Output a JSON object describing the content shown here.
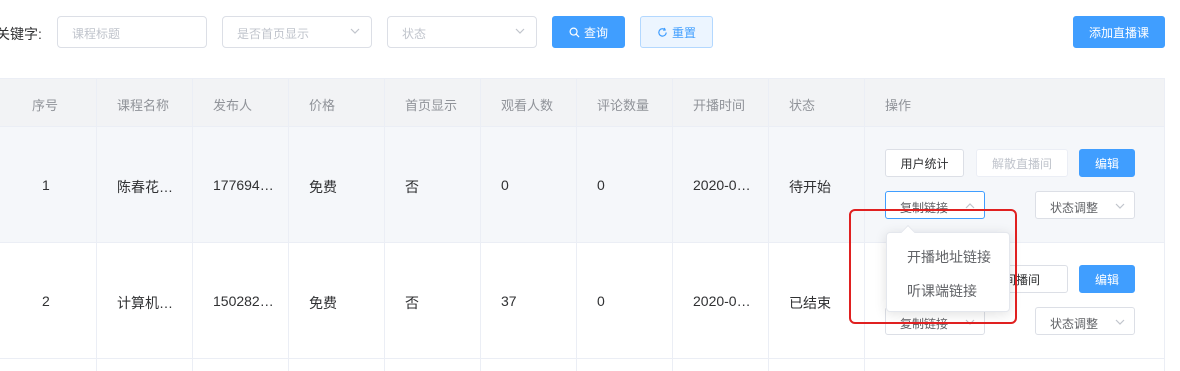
{
  "filters": {
    "keyword_label": "关键字:",
    "title_placeholder": "课程标题",
    "homepage_placeholder": "是否首页显示",
    "status_placeholder": "状态",
    "search_label": "查询",
    "reset_label": "重置",
    "add_label": "添加直播课"
  },
  "table": {
    "columns": [
      "序号",
      "课程名称",
      "发布人",
      "价格",
      "首页显示",
      "观看人数",
      "评论数量",
      "开播时间",
      "状态",
      "操作"
    ],
    "rows": [
      {
        "index": "1",
        "name": "陈春花…",
        "publisher": "177694…",
        "price": "免费",
        "homepage": "否",
        "viewers": "0",
        "comments": "0",
        "start_time": "2020-0…",
        "status": "待开始"
      },
      {
        "index": "2",
        "name": "计算机…",
        "publisher": "150282…",
        "price": "免费",
        "homepage": "否",
        "viewers": "37",
        "comments": "0",
        "start_time": "2020-0…",
        "status": "已结束"
      }
    ],
    "actions": {
      "user_stats": "用户统计",
      "dissolve_room": "解散直播间",
      "dissolve_room_partial": "间播间",
      "edit": "编辑",
      "copy_link": "复制链接",
      "status_adjust": "状态调整"
    }
  },
  "dropdown": {
    "items": [
      "开播地址链接",
      "听课端链接"
    ]
  },
  "colors": {
    "primary": "#409eff",
    "highlight_box": "#e02020"
  }
}
